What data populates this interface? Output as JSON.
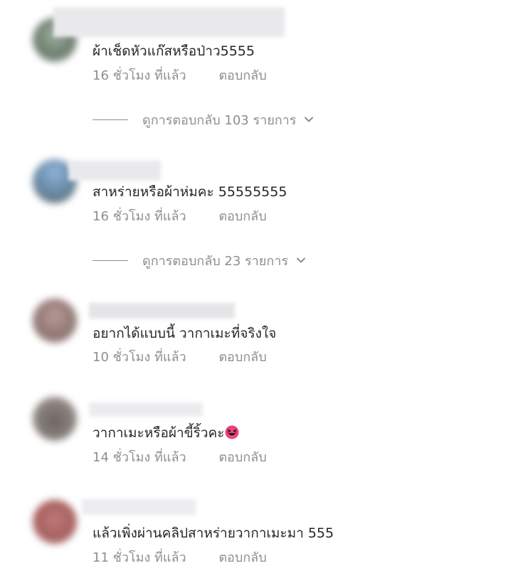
{
  "comments": [
    {
      "text": "ผ้าเช็ดหัวแก๊สหรือป่าว5555",
      "time": "16 ชั่วโมง ที่แล้ว",
      "reply": "ตอบกลับ",
      "view_replies": "ดูการตอบกลับ 103 รายการ"
    },
    {
      "text": "สาหร่ายหรือผ้าห่มคะ 55555555",
      "time": "16 ชั่วโมง ที่แล้ว",
      "reply": "ตอบกลับ",
      "view_replies": "ดูการตอบกลับ 23 รายการ"
    },
    {
      "text": "อยากได้แบบนี้ วากาเมะที่จริงใจ",
      "time": "10 ชั่วโมง ที่แล้ว",
      "reply": "ตอบกลับ"
    },
    {
      "text": "วากาเมะหรือผ้าขี้ริ้วคะ",
      "emoji": "squinting-laughing-face-emoji",
      "time": "14 ชั่วโมง ที่แล้ว",
      "reply": "ตอบกลับ"
    },
    {
      "text": "แล้วเพิ่งผ่านคลิปสาหร่ายวากาเมะมา 555",
      "time": "11 ชั่วโมง ที่แล้ว",
      "reply": "ตอบกลับ"
    }
  ],
  "colors": {
    "text": "#262626",
    "secondary": "#8e8e8e",
    "background": "#ffffff"
  }
}
